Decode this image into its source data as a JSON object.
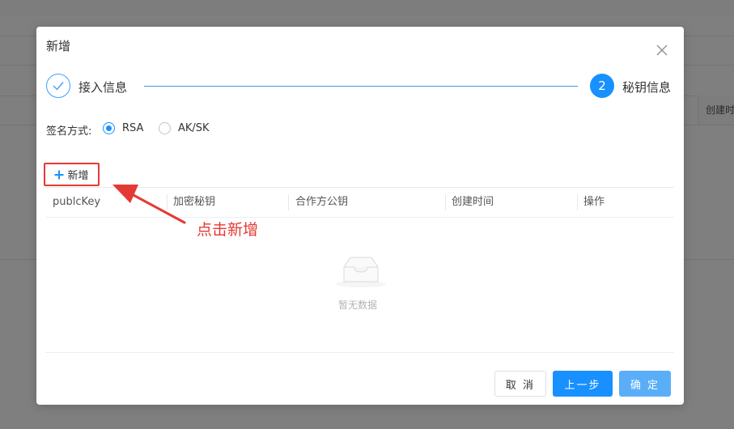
{
  "background": {
    "header_cell": "创建时间"
  },
  "dialog": {
    "title": "新增",
    "steps": [
      {
        "label": "接入信息",
        "status": "done"
      },
      {
        "number": "2",
        "label": "秘钥信息",
        "status": "active"
      }
    ],
    "sign_method": {
      "label": "签名方式:",
      "options": [
        "RSA",
        "AK/SK"
      ],
      "selected": "RSA"
    },
    "add_button_label": "新增",
    "table": {
      "columns": [
        "publcKey",
        "加密秘钥",
        "合作方公钥",
        "创建时间",
        "操作"
      ],
      "empty_text": "暂无数据"
    },
    "footer": {
      "cancel_label": "取 消",
      "prev_label": "上一步",
      "confirm_label": "确 定"
    }
  },
  "annotation": {
    "text": "点击新增",
    "color": "#e53935"
  },
  "colors": {
    "primary": "#1890ff",
    "primary_light": "#5aaef8",
    "highlight_red": "#e53935"
  }
}
